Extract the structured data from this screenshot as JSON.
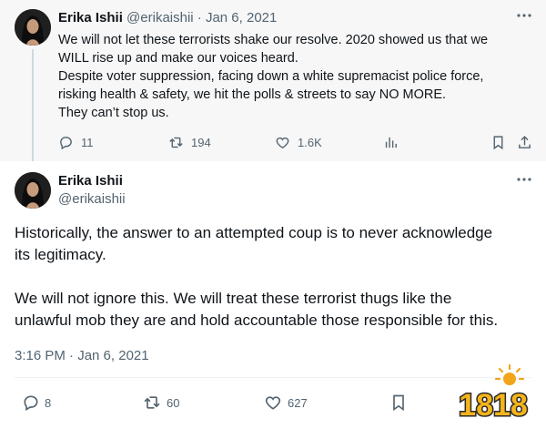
{
  "parent_tweet": {
    "author_name": "Erika Ishii",
    "handle_date": "@erikaishii · Jan 6, 2021",
    "lines": [
      "We will not let these terrorists shake our resolve. 2020 showed us that we",
      "WILL rise up and make our voices heard.",
      "Despite voter suppression, facing down a white supremacist police force,",
      "risking health & safety, we hit the polls & streets to say NO MORE.",
      "They can’t stop us."
    ],
    "replies": "11",
    "retweets": "194",
    "likes": "1.6K"
  },
  "main_tweet": {
    "author_name": "Erika Ishii",
    "handle": "@erikaishii",
    "paragraph1": [
      "Historically, the answer to an attempted coup is to never acknowledge",
      "its legitimacy."
    ],
    "paragraph2": [
      "We will not ignore this. We will treat these terrorist thugs like the",
      "unlawful mob they are and hold accountable those responsible for this."
    ],
    "timestamp": "3:16 PM · Jan 6, 2021",
    "replies": "8",
    "retweets": "60",
    "likes": "627"
  },
  "icons": {
    "more": "more-dots-icon",
    "reply": "reply-bubble-icon",
    "retweet": "retweet-icon",
    "like": "heart-icon",
    "views": "analytics-bars-icon",
    "bookmark": "bookmark-icon",
    "share": "share-upload-icon"
  },
  "colors": {
    "text": "#0f1419",
    "secondary": "#536471",
    "parent_bg": "#f7f7f7",
    "thread_line": "#cfd9de"
  },
  "watermark": "1818"
}
